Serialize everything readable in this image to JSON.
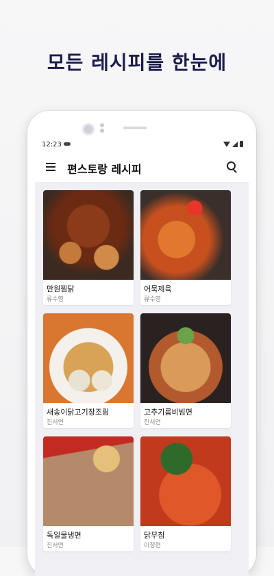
{
  "promo": {
    "headline": "모든 레시피를 한눈에"
  },
  "status_bar": {
    "time": "12:23",
    "icons": [
      "cloud-icon",
      "wifi-icon",
      "signal-icon",
      "battery-icon"
    ]
  },
  "app_bar": {
    "title": "편스토랑 레시피",
    "menu_icon": "menu-icon",
    "search_icon": "search-icon"
  },
  "recipes": [
    {
      "name": "만원찜닭",
      "author": "류수영"
    },
    {
      "name": "어묵제육",
      "author": "류수영"
    },
    {
      "name": "새송이닭고기장조림",
      "author": "진서연"
    },
    {
      "name": "고추기름비빔면",
      "author": "진서연"
    },
    {
      "name": "독일물냉면",
      "author": "진서연"
    },
    {
      "name": "닭무침",
      "author": "이정현"
    }
  ],
  "colors": {
    "headline": "#1a1c4a",
    "screen_bg": "#f0f0f4"
  }
}
